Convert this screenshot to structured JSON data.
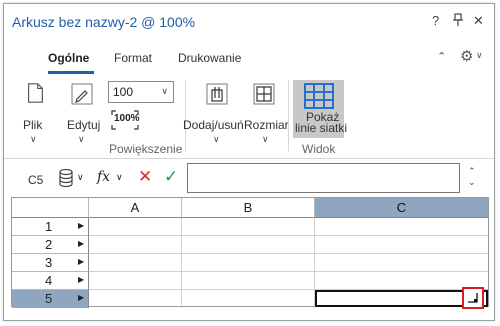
{
  "window": {
    "title": "Arkusz bez nazwy-2 @ 100%",
    "help_label": "?",
    "pin_label": "⊥",
    "close_label": "✕"
  },
  "tabs": [
    {
      "label": "Ogólne",
      "active": true
    },
    {
      "label": "Format",
      "active": false
    },
    {
      "label": "Drukowanie",
      "active": false
    }
  ],
  "ribbon": {
    "plik_label": "Plik",
    "edytuj_label": "Edytuj",
    "zoom_value": "100",
    "zoom_icon_text": "100%",
    "zoom_group_label": "Powiększenie",
    "dodaj_label": "Dodaj/usuń",
    "rozmiar_label": "Rozmiar",
    "gridlines_label_1": "Pokaż",
    "gridlines_label_2": "linie siatki",
    "widok_group_label": "Widok"
  },
  "formula_bar": {
    "cell_ref": "C5",
    "fx_label": "fx",
    "formula_value": ""
  },
  "sheet": {
    "columns": [
      "A",
      "B",
      "C"
    ],
    "selected_column": "C",
    "rows": [
      "1",
      "2",
      "3",
      "4",
      "5"
    ],
    "selected_row": "5",
    "active_cell": "C5"
  },
  "colors": {
    "accent": "#1f5ea8",
    "selection": "#8ea6bf",
    "highlight_box": "#d42020",
    "grid_icon": "#2a6fcc",
    "cancel": "#e02828",
    "confirm": "#1ea03c"
  }
}
